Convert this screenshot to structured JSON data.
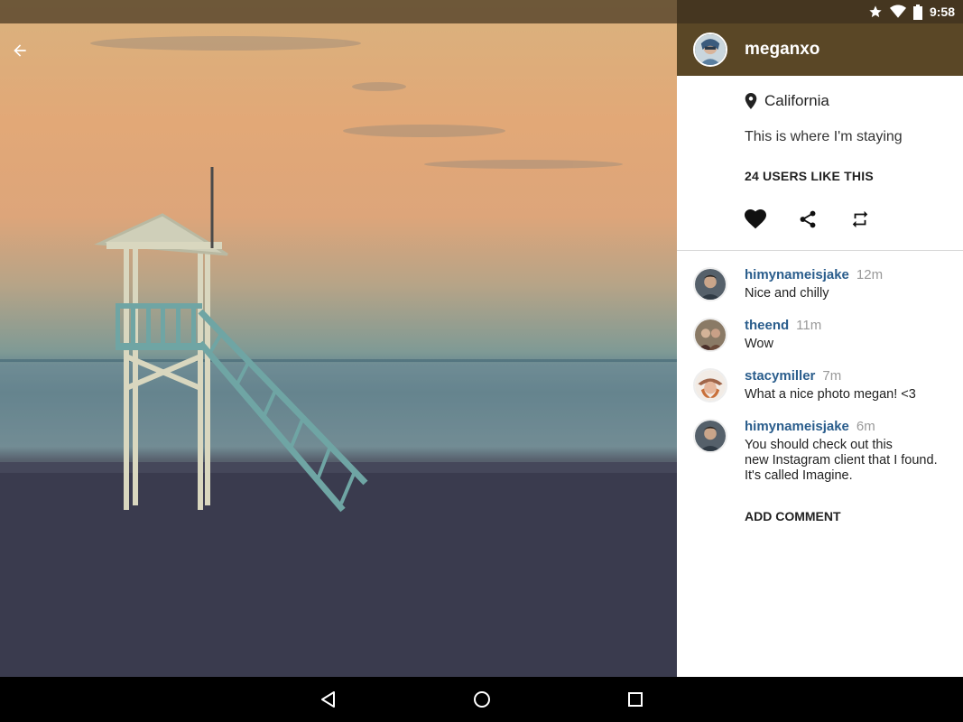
{
  "status_bar": {
    "time": "9:58",
    "icons": [
      "star-icon",
      "wifi-icon",
      "battery-icon"
    ]
  },
  "post": {
    "owner": "meganxo",
    "location": "California",
    "caption": "This is where I'm staying",
    "likes_text": "24 USERS LIKE THIS"
  },
  "comments": [
    {
      "user": "himynameisjake",
      "time": "12m",
      "text": "Nice and chilly"
    },
    {
      "user": "theend",
      "time": "11m",
      "text": "Wow"
    },
    {
      "user": "stacymiller",
      "time": "7m",
      "text": "What a nice photo megan! <3"
    },
    {
      "user": "himynameisjake",
      "time": "6m",
      "text": "You should check out this\nnew Instagram client that I found.\nIt's called Imagine."
    }
  ],
  "add_comment_label": "ADD COMMENT",
  "colors": {
    "header": "#5a4726",
    "status_bar": "#453620",
    "username": "#2a5d8c"
  }
}
